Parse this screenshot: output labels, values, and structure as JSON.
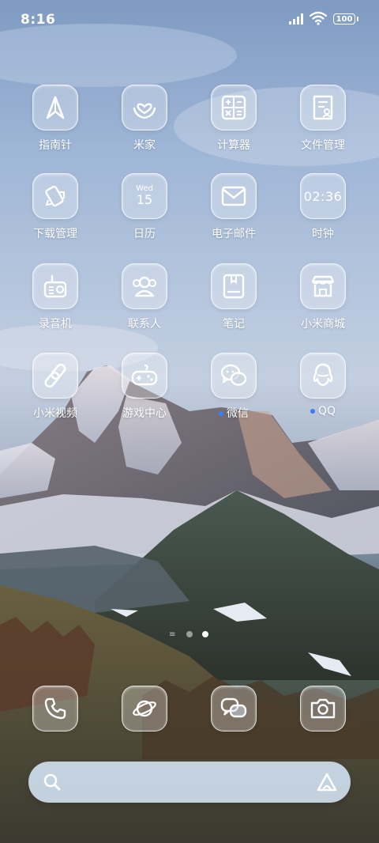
{
  "status_bar": {
    "time": "8:16",
    "battery": "100"
  },
  "apps": [
    {
      "label": "指南针",
      "icon": "compass-icon",
      "badge": false
    },
    {
      "label": "米家",
      "icon": "mi-home-icon",
      "badge": false
    },
    {
      "label": "计算器",
      "icon": "calculator-icon",
      "badge": false
    },
    {
      "label": "文件管理",
      "icon": "file-manager-icon",
      "badge": false
    },
    {
      "label": "下载管理",
      "icon": "download-manager-icon",
      "badge": false
    },
    {
      "label": "日历",
      "icon": "calendar-icon",
      "badge": false,
      "weekday": "Wed",
      "day": "15"
    },
    {
      "label": "电子邮件",
      "icon": "email-icon",
      "badge": false
    },
    {
      "label": "时钟",
      "icon": "clock-icon",
      "badge": false,
      "time": "02:36"
    },
    {
      "label": "录音机",
      "icon": "recorder-icon",
      "badge": false
    },
    {
      "label": "联系人",
      "icon": "contacts-icon",
      "badge": false
    },
    {
      "label": "笔记",
      "icon": "notes-icon",
      "badge": false
    },
    {
      "label": "小米商城",
      "icon": "mi-store-icon",
      "badge": false
    },
    {
      "label": "小米视频",
      "icon": "mi-video-icon",
      "badge": false
    },
    {
      "label": "游戏中心",
      "icon": "game-center-icon",
      "badge": false
    },
    {
      "label": "微信",
      "icon": "wechat-icon",
      "badge": true
    },
    {
      "label": "QQ",
      "icon": "qq-icon",
      "badge": true
    }
  ],
  "pager": {
    "page_count": 2,
    "current_page": 2,
    "menu_icon": "list-icon"
  },
  "dock": [
    {
      "icon": "phone-icon"
    },
    {
      "icon": "browser-icon"
    },
    {
      "icon": "messages-icon"
    },
    {
      "icon": "camera-icon"
    }
  ],
  "search_bar": {
    "search_icon": "search-icon",
    "assistant_icon": "assistant-icon"
  },
  "colors": {
    "badge": "#3a7bff",
    "search_bg": "#d2e1f2",
    "icon_stroke": "#ffffff"
  }
}
